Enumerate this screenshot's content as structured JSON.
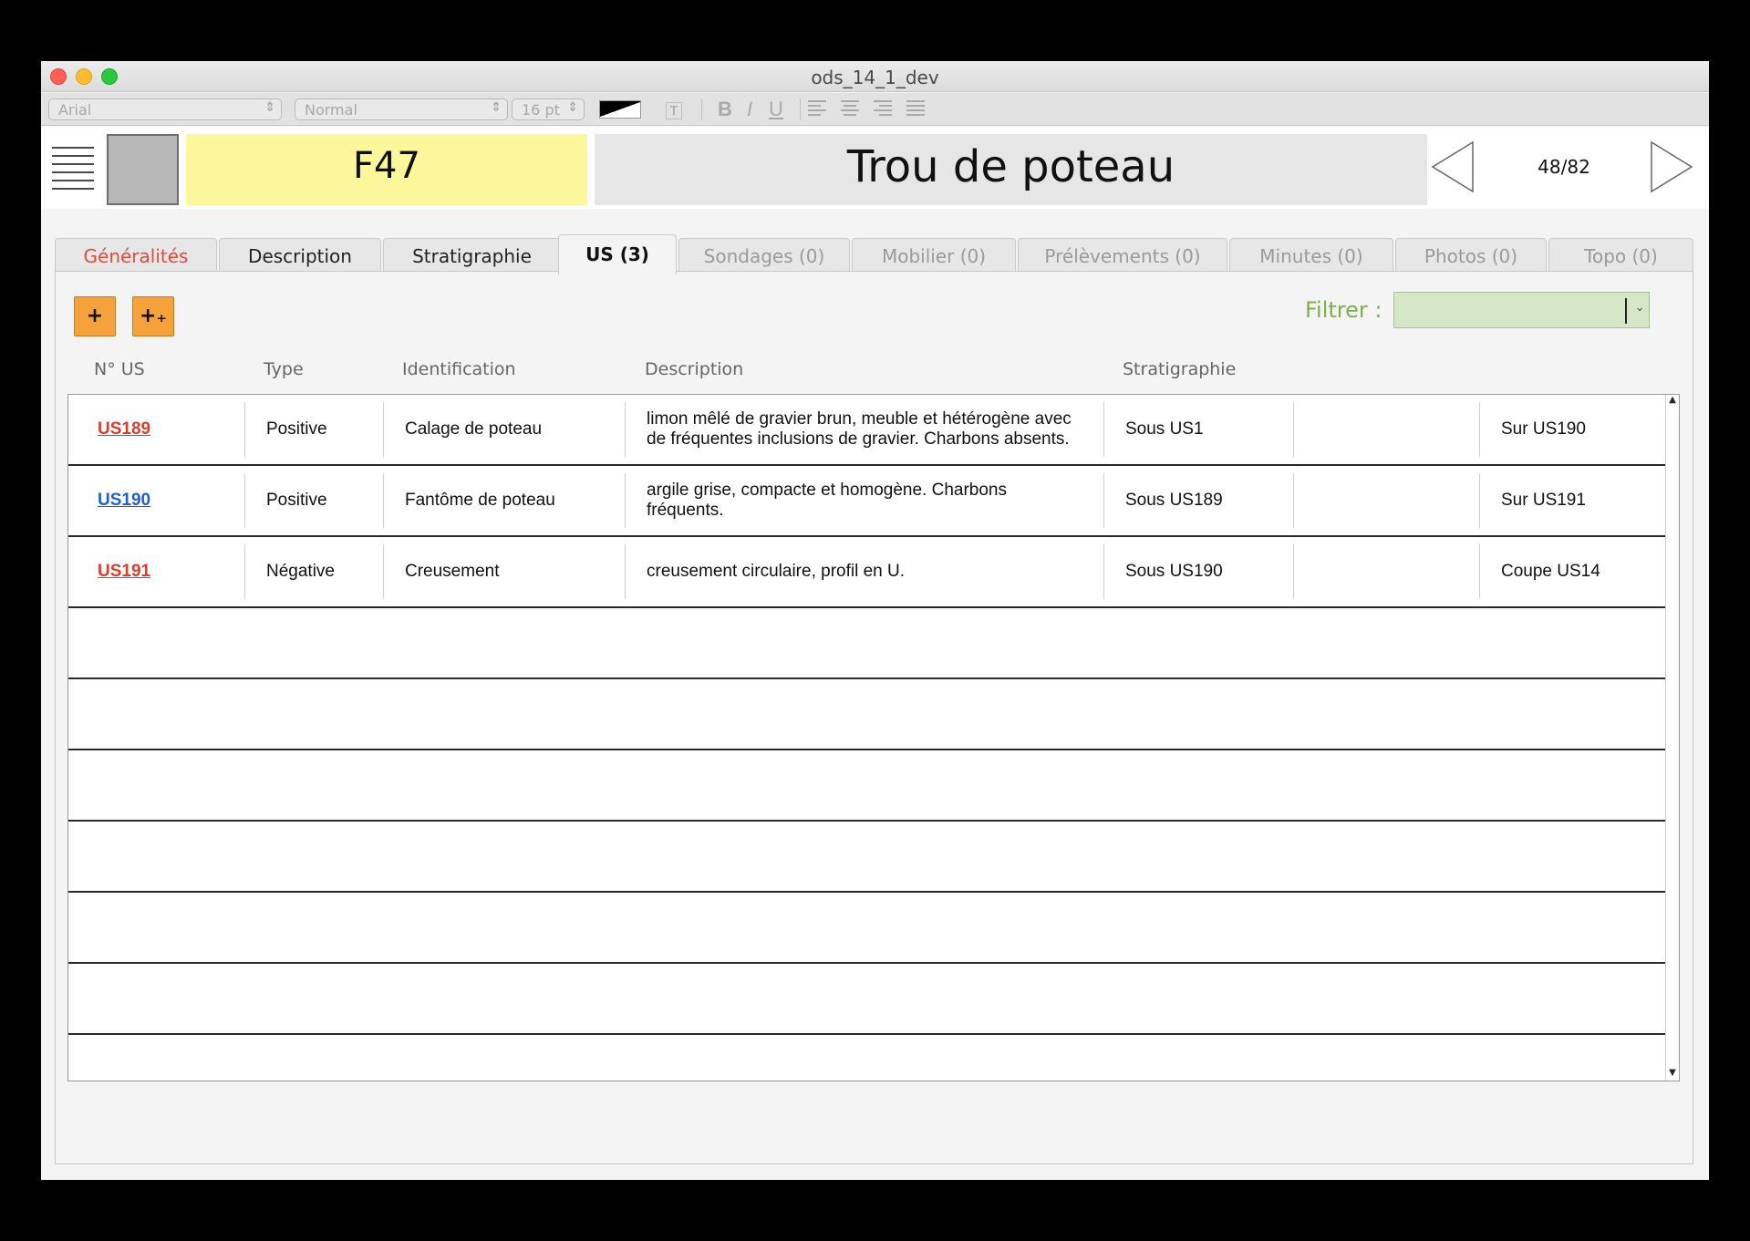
{
  "window": {
    "title": "ods_14_1_dev"
  },
  "format_toolbar": {
    "font": "Arial",
    "style": "Normal",
    "size": "16 pt",
    "bold": "B",
    "italic": "I",
    "underline": "U"
  },
  "header": {
    "id": "F47",
    "name": "Trou de poteau",
    "pager": "48/82"
  },
  "tabs": [
    {
      "label": "Généralités"
    },
    {
      "label": "Description"
    },
    {
      "label": "Stratigraphie"
    },
    {
      "label": "US (3)"
    },
    {
      "label": "Sondages (0)"
    },
    {
      "label": "Mobilier (0)"
    },
    {
      "label": "Prélèvements (0)"
    },
    {
      "label": "Minutes (0)"
    },
    {
      "label": "Photos (0)"
    },
    {
      "label": "Topo (0)"
    }
  ],
  "actions": {
    "add_label": "+",
    "add_multi_label": "+₊"
  },
  "filter": {
    "label": "Filtrer :",
    "value": ""
  },
  "columns": {
    "num": "N° US",
    "type": "Type",
    "identification": "Identification",
    "description": "Description",
    "stratigraphie": "Stratigraphie"
  },
  "rows": [
    {
      "num": "US189",
      "type": "Positive",
      "identification": "Calage de poteau",
      "description": "limon mêlé de gravier brun, meuble et hétérogène avec de fréquentes inclusions de gravier. Charbons absents.",
      "strat1": "Sous US1",
      "strat2": "",
      "strat3": "Sur US190"
    },
    {
      "num": "US190",
      "type": "Positive",
      "identification": "Fantôme de poteau",
      "description": "argile grise, compacte et homogène. Charbons fréquents.",
      "strat1": "Sous US189",
      "strat2": "",
      "strat3": "Sur US191"
    },
    {
      "num": "US191",
      "type": "Négative",
      "identification": "Creusement",
      "description": "creusement circulaire, profil en U.",
      "strat1": "Sous US190",
      "strat2": "",
      "strat3": "Coupe US14"
    }
  ],
  "colors": {
    "id_box": "#fdf79c",
    "add_button": "#f5a23b",
    "filter_label": "#7fb04b",
    "filter_field": "#d5e7c7",
    "link_red": "#e03a2a",
    "link_blue": "#1f5fd1"
  }
}
